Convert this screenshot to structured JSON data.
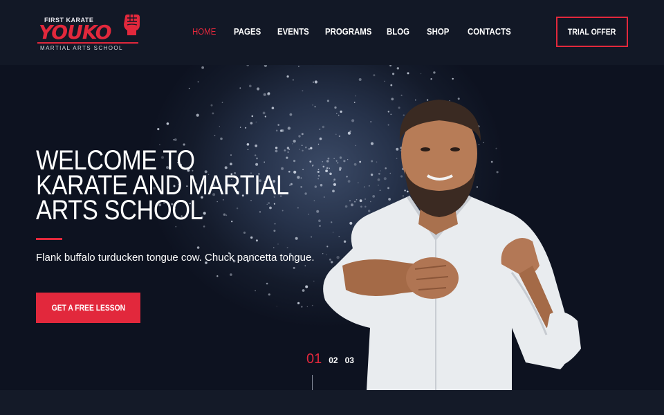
{
  "brand": {
    "top_text": "FIRST KARATE",
    "name": "YOUKO",
    "tagline": "MARTIAL ARTS SCHOOL",
    "accent": "#e2283c"
  },
  "nav": {
    "items": [
      {
        "label": "HOME",
        "active": true
      },
      {
        "label": "PAGES",
        "active": false
      },
      {
        "label": "EVENTS",
        "active": false
      },
      {
        "label": "PROGRAMS",
        "active": false
      },
      {
        "label": "BLOG",
        "active": false
      },
      {
        "label": "SHOP",
        "active": false
      },
      {
        "label": "CONTACTS",
        "active": false
      }
    ],
    "cta_label": "TRIAL OFFER"
  },
  "hero": {
    "title_lines": [
      "WELCOME TO",
      "KARATE AND MARTIAL",
      "ARTS SCHOOL"
    ],
    "subtitle": "Flank buffalo turducken tongue cow. Chuck pancetta tongue.",
    "button_label": "GET A FREE LESSON",
    "slides": [
      "01",
      "02",
      "03"
    ],
    "active_slide": "01",
    "image_icon": "karate-fighter-image"
  },
  "colors": {
    "background": "#121826",
    "accent": "#e2283c",
    "text": "#ffffff"
  }
}
